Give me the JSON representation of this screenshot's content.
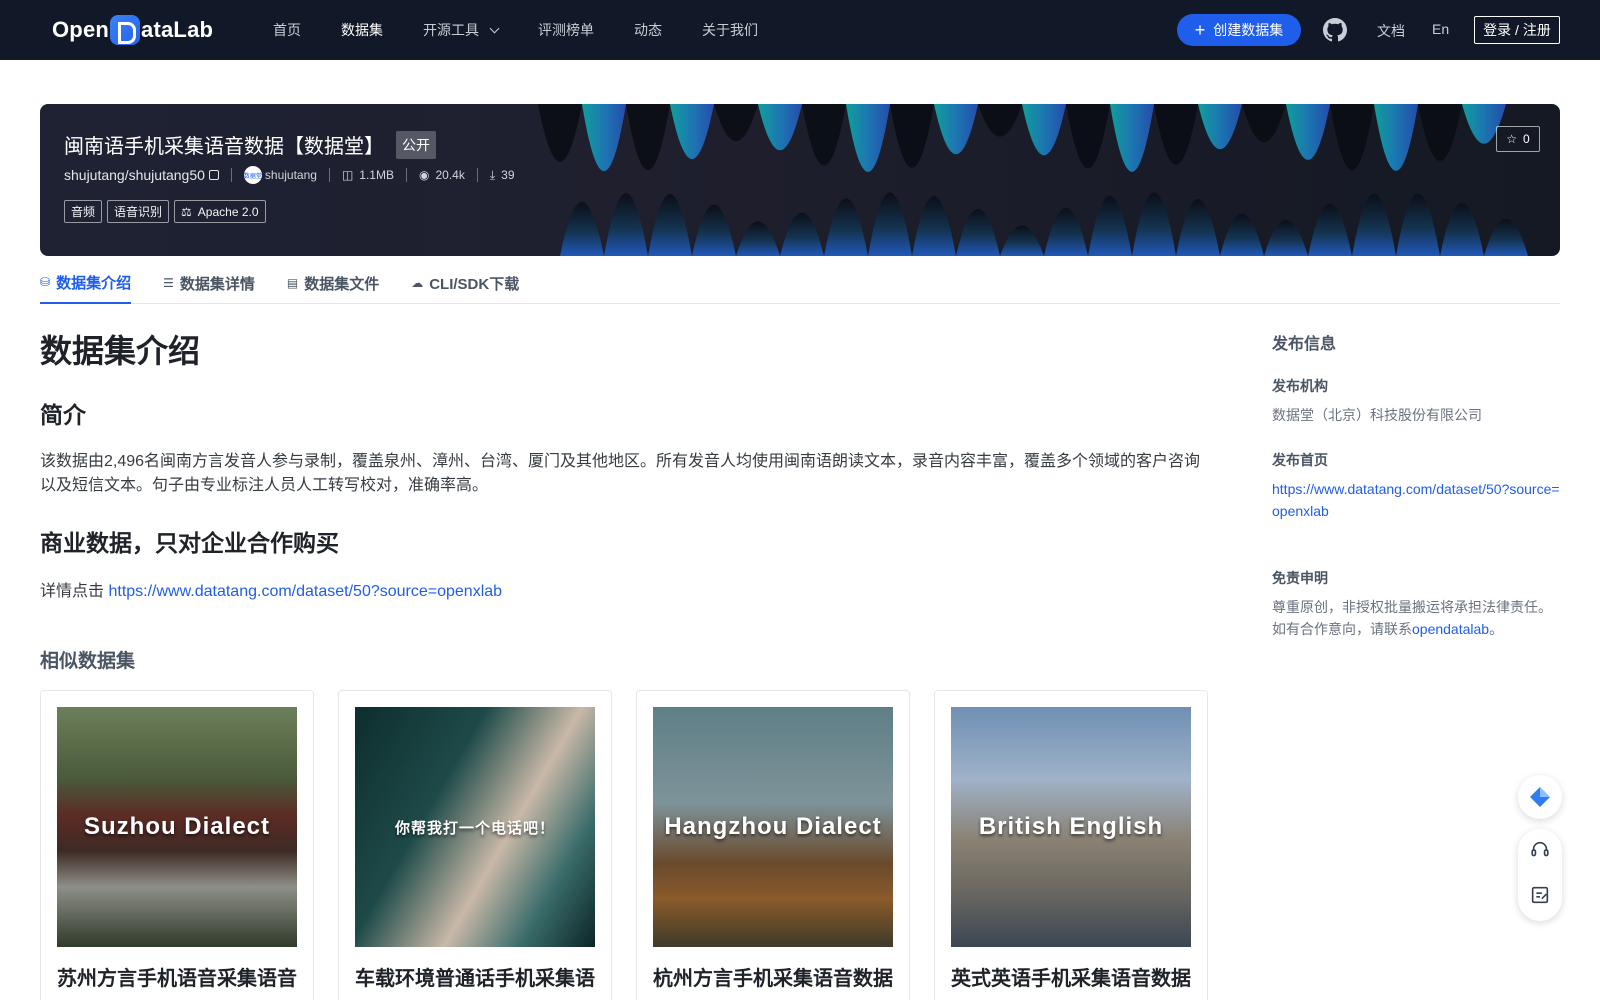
{
  "nav": {
    "logo_text_left": "Open",
    "logo_text_right": "ataLab",
    "links": [
      "首页",
      "数据集",
      "开源工具",
      "评测榜单",
      "动态",
      "关于我们"
    ],
    "create_label": "创建数据集",
    "docs": "文档",
    "lang": "En",
    "login": "登录 / 注册"
  },
  "banner": {
    "title": "闽南语手机采集语音数据【数据堂】",
    "visibility": "公开",
    "repo": "shujutang/shujutang50",
    "owner": "shujutang",
    "avatar_text": "数据堂",
    "size": "1.1MB",
    "views": "20.4k",
    "downloads": "39",
    "tags": [
      "音频",
      "语音识别"
    ],
    "license": "Apache 2.0",
    "stars": "0"
  },
  "tabs": [
    "数据集介绍",
    "数据集详情",
    "数据集文件",
    "CLI/SDK下载"
  ],
  "content": {
    "heading": "数据集介绍",
    "intro_heading": "简介",
    "intro_text": "该数据由2,496名闽南方言发音人参与录制，覆盖泉州、漳州、台湾、厦门及其他地区。所有发音人均使用闽南语朗读文本，录音内容丰富，覆盖多个领域的客户咨询以及短信文本。句子由专业标注人员人工转写校对，准确率高。",
    "commercial_heading": "商业数据，只对企业合作购买",
    "detail_prefix": "详情点击",
    "detail_link": "https://www.datatang.com/dataset/50?source=openxlab",
    "similar_heading": "相似数据集"
  },
  "cards": [
    {
      "image_text": "Suzhou Dialect",
      "title": "苏州方言手机语音采集语音数据【数据堂】"
    },
    {
      "image_text": "你帮我打一个电话吧！",
      "title": "车载环境普通话手机采集语音数据【数据堂】"
    },
    {
      "image_text": "Hangzhou Dialect",
      "title": "杭州方言手机采集语音数据【数据堂】"
    },
    {
      "image_text": "British English",
      "title": "英式英语手机采集语音数据【数据堂】"
    }
  ],
  "sidebar": {
    "heading": "发布信息",
    "org_label": "发布机构",
    "org_value": "数据堂（北京）科技股份有限公司",
    "home_label": "发布首页",
    "home_link": "https://www.datatang.com/dataset/50?source=openxlab",
    "disclaimer_label": "免责申明",
    "disclaimer_text": "尊重原创，非授权批量搬运将承担法律责任。如有合作意向，请联系",
    "disclaimer_link": "opendatalab",
    "disclaimer_end": "。"
  },
  "colors": {
    "nav_bg": "#111827",
    "accent": "#1f5eea"
  }
}
